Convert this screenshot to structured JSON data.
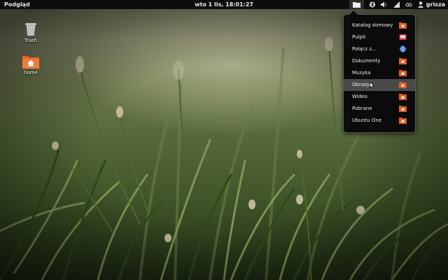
{
  "top_panel": {
    "activities_label": "Podgląd",
    "clock": "wto  1 lis, 18:01:27",
    "user_name": "grisza",
    "tray_icons": [
      "folder-icon",
      "bluetooth-icon",
      "volume-icon",
      "signal-icon",
      "accessibility-icon",
      "user-icon"
    ]
  },
  "desktop": {
    "icons": [
      {
        "label": "Trash",
        "icon": "trash-icon"
      },
      {
        "label": "home",
        "icon": "home-folder-icon"
      }
    ]
  },
  "places_menu": {
    "hovered_item": "Obrazy",
    "items": [
      {
        "label": "Katalog domowy",
        "icon": "home-folder-icon",
        "color": "#e25b20"
      },
      {
        "label": "Pulpit",
        "icon": "desktop-icon",
        "color": "#c83c5a"
      },
      {
        "label": "Połącz z...",
        "icon": "network-globe-icon",
        "color": "#3c7bd6"
      },
      {
        "label": "Dokumenty",
        "icon": "documents-folder-icon",
        "color": "#e25b20"
      },
      {
        "label": "Muzyka",
        "icon": "music-folder-icon",
        "color": "#e25b20"
      },
      {
        "label": "Obrazy",
        "icon": "pictures-folder-icon",
        "color": "#e25b20"
      },
      {
        "label": "Wideo",
        "icon": "videos-folder-icon",
        "color": "#e25b20"
      },
      {
        "label": "Pobrane",
        "icon": "downloads-folder-icon",
        "color": "#e25b20"
      },
      {
        "label": "Ubuntu One",
        "icon": "ubuntu-one-folder-icon",
        "color": "#e25b20"
      }
    ]
  }
}
